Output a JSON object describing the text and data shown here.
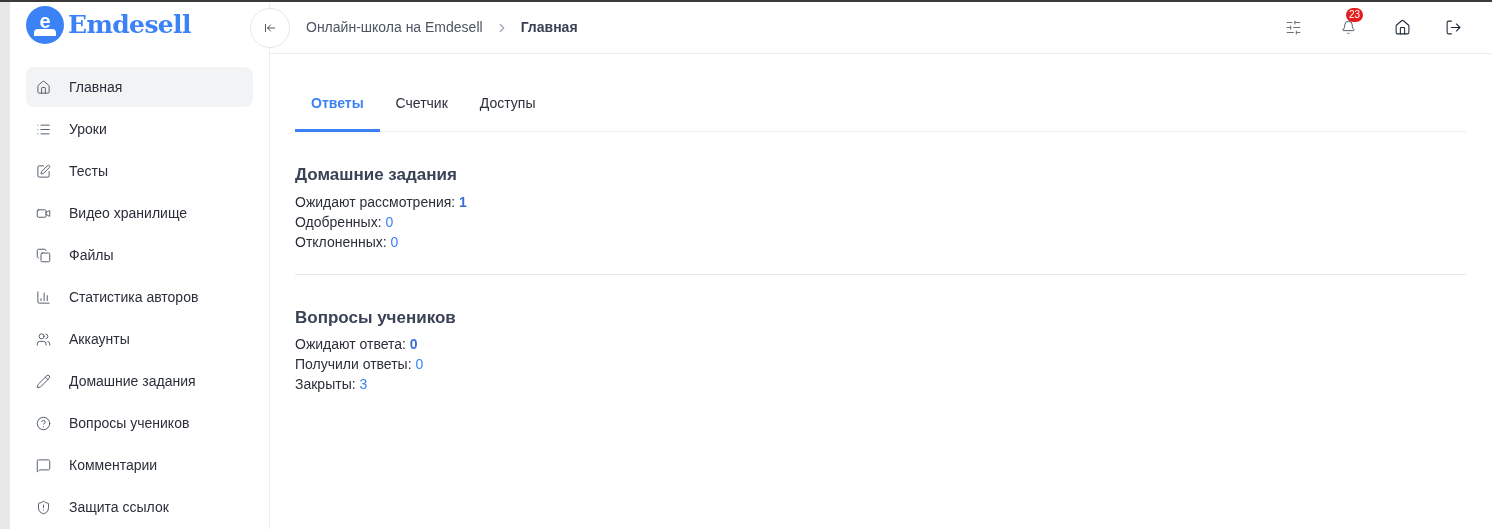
{
  "logo": {
    "letter": "e",
    "name": "Emdesell"
  },
  "breadcrumbs": [
    {
      "label": "Онлайн-школа на Emdesell",
      "current": false
    },
    {
      "label": "Главная",
      "current": true
    }
  ],
  "notifications": {
    "count": "23"
  },
  "sidebar": {
    "items": [
      {
        "label": "Главная",
        "selected": true
      },
      {
        "label": "Уроки",
        "selected": false
      },
      {
        "label": "Тесты",
        "selected": false
      },
      {
        "label": "Видео хранилище",
        "selected": false
      },
      {
        "label": "Файлы",
        "selected": false
      },
      {
        "label": "Статистика авторов",
        "selected": false
      },
      {
        "label": "Аккаунты",
        "selected": false
      },
      {
        "label": "Домашние задания",
        "selected": false
      },
      {
        "label": "Вопросы учеников",
        "selected": false
      },
      {
        "label": "Комментарии",
        "selected": false
      },
      {
        "label": "Защита ссылок",
        "selected": false
      }
    ]
  },
  "tabs": [
    {
      "label": "Ответы",
      "selected": true
    },
    {
      "label": "Счетчик",
      "selected": false
    },
    {
      "label": "Доступы",
      "selected": false
    }
  ],
  "sections": [
    {
      "title": "Домашние задания",
      "stats": [
        {
          "label": "Ожидают рассмотрения:",
          "value": "1",
          "emphasized": true
        },
        {
          "label": "Одобренных:",
          "value": "0",
          "emphasized": false
        },
        {
          "label": "Отклоненных:",
          "value": "0",
          "emphasized": false
        }
      ]
    },
    {
      "title": "Вопросы учеников",
      "stats": [
        {
          "label": "Ожидают ответа:",
          "value": "0",
          "emphasized": true
        },
        {
          "label": "Получили ответы:",
          "value": "0",
          "emphasized": false
        },
        {
          "label": "Закрыты:",
          "value": "3",
          "emphasized": false
        }
      ]
    }
  ]
}
